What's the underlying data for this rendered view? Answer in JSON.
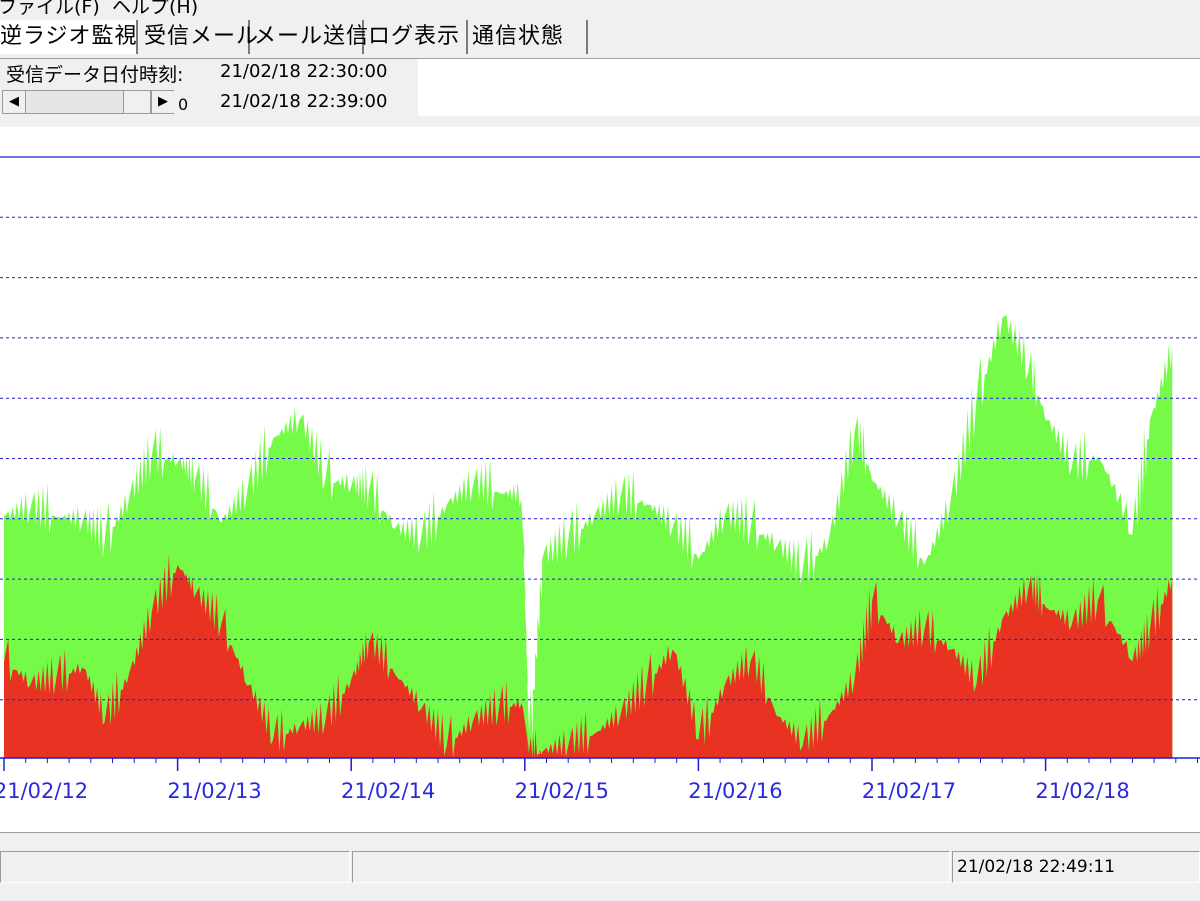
{
  "menu": [
    "ファイル(F)",
    "ヘルプ(H)"
  ],
  "tabs": [
    "逆ラジオ監視",
    "受信メール",
    "メール送信",
    "ログ表示",
    "通信状態"
  ],
  "info": {
    "label": "受信データ日付時刻:",
    "time_start": "21/02/18 22:30:00",
    "time_end": "21/02/18 22:39:00",
    "scroll_value": "0"
  },
  "chart_data": {
    "type": "area",
    "x_tick_labels": [
      "21/02/12",
      "21/02/13",
      "21/02/14",
      "21/02/15",
      "21/02/16",
      "21/02/17",
      "21/02/18"
    ],
    "grid": true,
    "colors": {
      "upper": "#76fa48",
      "lower": "#e83322",
      "grid": "#1f1fd0",
      "axis_text": "#2a2adf"
    },
    "series": [
      {
        "color": "#76fa48",
        "x": [
          0.0,
          0.15,
          0.3,
          0.45,
          0.58,
          0.72,
          0.85,
          1.0,
          1.1,
          1.25,
          1.4,
          1.55,
          1.7,
          1.85,
          2.0,
          2.1,
          2.25,
          2.4,
          2.55,
          2.7,
          2.85,
          2.98,
          3.02,
          3.1,
          3.25,
          3.4,
          3.55,
          3.7,
          3.85,
          4.0,
          4.15,
          4.3,
          4.45,
          4.6,
          4.75,
          4.9,
          5.0,
          5.15,
          5.3,
          5.45,
          5.6,
          5.75,
          5.9,
          6.0,
          6.15,
          6.3,
          6.5,
          6.6,
          6.73
        ],
        "y": [
          4.0,
          4.1,
          4.0,
          3.9,
          3.6,
          4.3,
          5.0,
          4.9,
          4.6,
          3.9,
          4.4,
          5.3,
          5.6,
          4.6,
          4.5,
          4.4,
          3.8,
          3.6,
          4.2,
          4.5,
          4.4,
          4.3,
          0.05,
          3.3,
          3.6,
          4.0,
          4.3,
          4.2,
          3.8,
          3.3,
          4.0,
          3.8,
          3.5,
          3.1,
          3.6,
          5.4,
          4.6,
          3.9,
          3.2,
          4.2,
          5.9,
          7.3,
          6.4,
          5.6,
          4.8,
          5.0,
          3.7,
          5.6,
          6.8
        ]
      },
      {
        "color": "#e83322",
        "x": [
          0.0,
          0.15,
          0.3,
          0.45,
          0.58,
          0.72,
          0.85,
          1.0,
          1.1,
          1.25,
          1.4,
          1.55,
          1.7,
          1.85,
          2.0,
          2.1,
          2.25,
          2.4,
          2.55,
          2.7,
          2.85,
          2.98,
          3.02,
          3.1,
          3.25,
          3.4,
          3.55,
          3.7,
          3.85,
          4.0,
          4.15,
          4.3,
          4.45,
          4.6,
          4.75,
          4.9,
          5.0,
          5.15,
          5.3,
          5.45,
          5.6,
          5.75,
          5.9,
          6.0,
          6.15,
          6.3,
          6.5,
          6.6,
          6.73
        ],
        "y": [
          1.6,
          1.2,
          1.3,
          1.5,
          0.6,
          1.4,
          2.4,
          3.2,
          2.7,
          2.2,
          1.2,
          0.3,
          0.5,
          0.6,
          1.3,
          1.9,
          1.4,
          0.8,
          0.2,
          0.6,
          0.8,
          0.9,
          0.0,
          0.1,
          0.2,
          0.4,
          0.7,
          1.2,
          1.8,
          0.3,
          1.2,
          1.6,
          0.7,
          0.2,
          0.7,
          1.3,
          2.6,
          1.9,
          2.1,
          1.8,
          1.2,
          2.3,
          2.8,
          2.5,
          2.2,
          2.6,
          1.6,
          2.1,
          3.0
        ]
      }
    ]
  },
  "status": {
    "panel1": "",
    "panel2": "",
    "datetime": "21/02/18 22:49:11"
  }
}
